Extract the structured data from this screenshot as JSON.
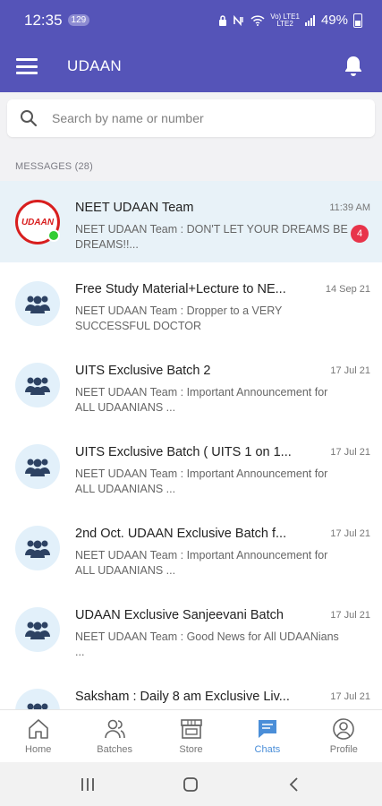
{
  "status_bar": {
    "time": "12:35",
    "badge": "129",
    "battery": "49%",
    "network_line1": "Vo) LTE1",
    "network_line2": "LTE2"
  },
  "app_bar": {
    "title": "UDAAN"
  },
  "search": {
    "placeholder": "Search by name or number"
  },
  "section": {
    "title": "MESSAGES (28)"
  },
  "chats": [
    {
      "name": "NEET UDAAN Team",
      "time": "11:39 AM",
      "preview": "NEET UDAAN Team :  DON'T LET YOUR DREAMS BE DREAMS!!...",
      "unread": "4",
      "logo_text": "UDAAN"
    },
    {
      "name": "Free Study Material+Lecture to NE...",
      "time": "14 Sep 21",
      "preview": "NEET UDAAN Team :  Dropper to a VERY SUCCESSFUL DOCTOR"
    },
    {
      "name": "UITS Exclusive Batch 2",
      "time": "17 Jul 21",
      "preview": "NEET UDAAN Team :  Important Announcement for ALL UDAANIANS ..."
    },
    {
      "name": "UITS Exclusive Batch ( UITS 1 on 1...",
      "time": "17 Jul 21",
      "preview": "NEET UDAAN Team :  Important Announcement for ALL UDAANIANS ..."
    },
    {
      "name": "2nd Oct. UDAAN Exclusive Batch f...",
      "time": "17 Jul 21",
      "preview": "NEET UDAAN Team :  Important Announcement for ALL UDAANIANS ..."
    },
    {
      "name": "UDAAN Exclusive Sanjeevani Batch",
      "time": "17 Jul 21",
      "preview": "NEET UDAAN Team :  Good News for All UDAANians ..."
    },
    {
      "name": "Saksham : Daily 8 am Exclusive Liv...",
      "time": "17 Jul 21",
      "preview": ""
    }
  ],
  "bottom_nav": [
    {
      "label": "Home",
      "icon": "home-icon"
    },
    {
      "label": "Batches",
      "icon": "batches-icon"
    },
    {
      "label": "Store",
      "icon": "store-icon"
    },
    {
      "label": "Chats",
      "icon": "chats-icon",
      "active": true
    },
    {
      "label": "Profile",
      "icon": "profile-icon"
    }
  ],
  "colors": {
    "primary": "#5554b8",
    "accent": "#4a8ed8",
    "badge": "#e8344a",
    "online": "#33cc33"
  }
}
